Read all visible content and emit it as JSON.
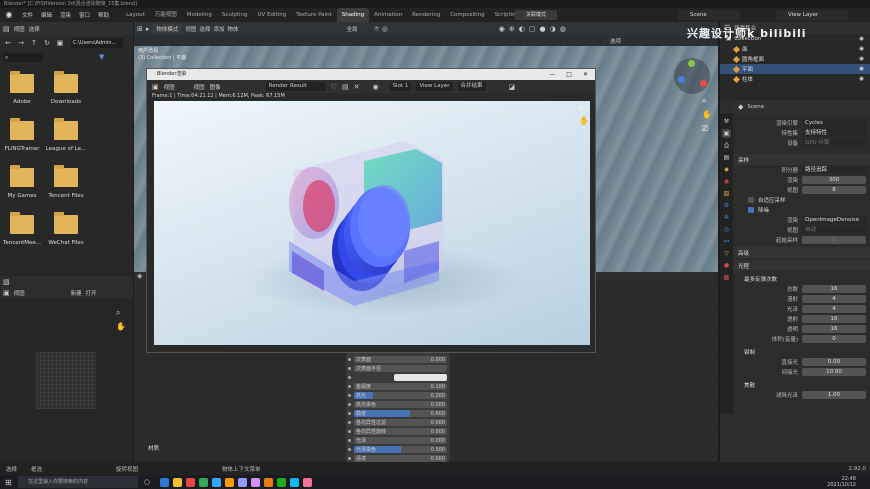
{
  "window_title": "Blender* [C:\\FISHVersion 3d\\混合渲染玻璃_15集.blend]",
  "menubar": {
    "menus": [
      "文件",
      "编辑",
      "渲染",
      "窗口",
      "帮助"
    ],
    "workspaces": [
      "Layout",
      "万能视图",
      "Modeling",
      "Sculpting",
      "UV Editing",
      "Texture Paint",
      "Shading",
      "Animation",
      "Rendering",
      "Compositing",
      "Scripting"
    ],
    "active_workspace": "Shading",
    "add_tab": "+",
    "mode_label": "关联模式",
    "scene": "Scene",
    "view_layer": "View Layer"
  },
  "file_browser": {
    "toolbar": [
      "视图",
      "选择"
    ],
    "path": "C:\\Users\\Admin...",
    "folders": [
      "Adobe",
      "Downloads",
      "",
      "FLiNGTrainer",
      "League of Le...",
      "",
      "My Games",
      "Tencent Files",
      "",
      "TencentMee...",
      "WeChat Files",
      ""
    ]
  },
  "image_panel": {
    "view": "视图",
    "new": "新建",
    "open": "打开"
  },
  "viewport": {
    "mode": "物体模式",
    "menus": [
      "视图",
      "选择",
      "添加",
      "物体"
    ],
    "header2": [
      "全局",
      "选项"
    ],
    "overlay_text": [
      "用户透视",
      "(3) Collection | 平面"
    ]
  },
  "render_window": {
    "title": "Blender渲染",
    "menus": [
      "视图",
      "视图",
      "图像"
    ],
    "image": "Render Result",
    "slot": "Slot 1",
    "layer": "View Layer",
    "pass": "合并结果",
    "info": "Frame:1 | Time:04:21.12 | Mem:6.12M, Peak: 67.15M",
    "controls": [
      "—",
      "□",
      "✕"
    ]
  },
  "node_editor": {
    "rows": [
      {
        "label": "次表面",
        "value": "0.000",
        "fill": 0
      },
      {
        "label": "次表面半径",
        "value": "",
        "fill": 0,
        "dropdown": true
      },
      {
        "label": "次表面颜色",
        "value": "",
        "fill": 0,
        "color": true
      },
      {
        "label": "金属度",
        "value": "0.100",
        "fill": 0
      },
      {
        "label": "高光",
        "value": "0.200",
        "fill": 0.2
      },
      {
        "label": "高光染色",
        "value": "0.000",
        "fill": 0
      },
      {
        "label": "糙度",
        "value": "0.600",
        "fill": 0.6
      },
      {
        "label": "各向异性过滤",
        "value": "0.000",
        "fill": 0
      },
      {
        "label": "各向异性旋转",
        "value": "0.000",
        "fill": 0
      },
      {
        "label": "光泽",
        "value": "0.000",
        "fill": 0
      },
      {
        "label": "光泽染色",
        "value": "0.500",
        "fill": 0.5
      },
      {
        "label": "清漆",
        "value": "0.000",
        "fill": 0
      }
    ],
    "material_label": "材质"
  },
  "outliner": {
    "header": "场景集合",
    "items": [
      {
        "name": "Collection",
        "selected": false
      },
      {
        "name": "面",
        "selected": false
      },
      {
        "name": "圆角框面",
        "selected": false
      },
      {
        "name": "平面",
        "selected": true
      },
      {
        "name": "柱体",
        "selected": false
      }
    ]
  },
  "properties": {
    "scene_label": "Scene",
    "engine_label": "渲染引擎",
    "engine": "Cycles",
    "feature_label": "特性集",
    "feature": "支持特性",
    "device_label": "设备",
    "device": "GPU 计算",
    "sections": {
      "sampling": "采样",
      "integrator": "积分器",
      "integrator_val": "路径追踪",
      "render_label": "渲染",
      "render_val": "300",
      "viewport_label": "视图",
      "viewport_val": "8",
      "adaptive": "自适应采样",
      "denoise": "降噪",
      "denoise_render": "渲染",
      "denoise_render_val": "OpenImageDenoise",
      "denoise_view": "视图",
      "denoise_view_val": "自动",
      "start_sample": "起始采样",
      "start_sample_val": "1",
      "advanced": "高级",
      "light_paths": "光程",
      "max_bounces": "最多反弹次数",
      "clamp": "钳制",
      "caustics": "焦散",
      "filter_glossy": "滤除光泽",
      "filter_glossy_val": "1.00"
    },
    "bounces": [
      {
        "label": "总数",
        "value": "16"
      },
      {
        "label": "漫射",
        "value": "4"
      },
      {
        "label": "光泽",
        "value": "4"
      },
      {
        "label": "透射",
        "value": "16"
      },
      {
        "label": "透明",
        "value": "16"
      },
      {
        "label": "体积(音量)",
        "value": "0"
      }
    ],
    "clamps": [
      {
        "label": "直接光",
        "value": "0.00"
      },
      {
        "label": "间接光",
        "value": "10.00"
      }
    ]
  },
  "status": {
    "items": [
      "选择",
      "框选",
      "旋转视图",
      "物体上下文菜单"
    ],
    "version": "2.92.0"
  },
  "taskbar": {
    "search": "在这里输入你要搜索的内容",
    "time": "22:48",
    "date": "2021/10/12"
  },
  "watermark": "兴趣设计师k bilibili",
  "colors": {
    "accent_blue": "#4772b3",
    "folder": "#e3b55a",
    "selected_row": "#35517a"
  }
}
